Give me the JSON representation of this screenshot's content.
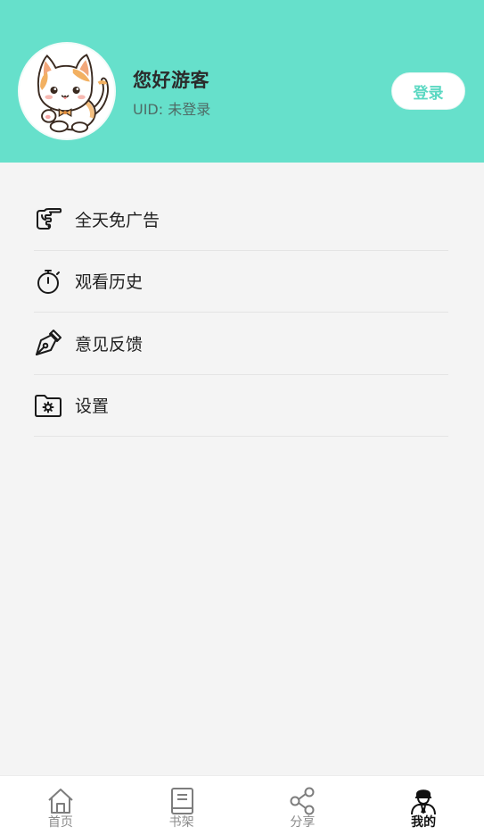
{
  "header": {
    "greeting": "您好游客",
    "uid": "UID: 未登录",
    "login_label": "登录",
    "background_color": "#66e0cb",
    "accent_color": "#5ad8c2"
  },
  "menu": {
    "items": [
      {
        "label": "全天免广告",
        "icon": "pointing-hand-icon"
      },
      {
        "label": "观看历史",
        "icon": "stopwatch-icon"
      },
      {
        "label": "意见反馈",
        "icon": "pen-nib-icon"
      },
      {
        "label": "设置",
        "icon": "folder-gear-icon"
      }
    ]
  },
  "tabbar": {
    "tabs": [
      {
        "label": "首页",
        "icon": "home-icon",
        "active": false
      },
      {
        "label": "书架",
        "icon": "book-icon",
        "active": false
      },
      {
        "label": "分享",
        "icon": "share-icon",
        "active": false
      },
      {
        "label": "我的",
        "icon": "profile-icon",
        "active": true
      }
    ]
  }
}
